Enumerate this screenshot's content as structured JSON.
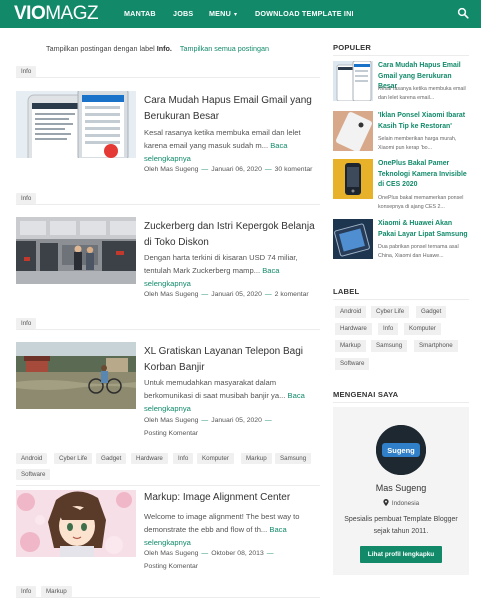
{
  "nav": {
    "logo_bold": "VIO",
    "logo_light": "MAGZ",
    "items": [
      "MANTAB",
      "JOBS",
      "MENU",
      "DOWNLOAD TEMPLATE INI"
    ],
    "menu_caret": "▾"
  },
  "notice": {
    "prefix": "Tampilkan postingan dengan label",
    "label": "Info.",
    "link": "Tampilkan semua postingan"
  },
  "posts": [
    {
      "tags": [
        "Info"
      ],
      "title": "Cara Mudah Hapus Email Gmail yang Berukuran Besar",
      "excerpt": "Kesal rasanya ketika membuka email dan lelet karena email yang masuk sudah m...",
      "more": "Baca selengkapnya",
      "author": "Oleh Mas Sugeng",
      "date": "Januari 06, 2020",
      "comments": "30 komentar"
    },
    {
      "tags": [
        "Info"
      ],
      "title": "Zuckerberg dan Istri Kepergok Belanja di Toko Diskon",
      "excerpt": "Dengan harta terkini di kisaran USD 74 miliar, tentulah Mark Zuckerberg mamp...",
      "more": "Baca selengkapnya",
      "author": "Oleh Mas Sugeng",
      "date": "Januari 05, 2020",
      "comments": "2 komentar"
    },
    {
      "tags": [
        "Info"
      ],
      "title": "XL Gratiskan Layanan Telepon Bagi Korban Banjir",
      "excerpt": "Untuk memudahkan masyarakat dalam berkomunikasi di saat musibah banjir ya...",
      "more": "Baca selengkapnya",
      "author": "Oleh Mas Sugeng",
      "date": "Januari 05, 2020",
      "comments": "Posting Komentar"
    },
    {
      "tags": [
        "Android",
        "Cyber Life",
        "Gadget",
        "Hardware",
        "Info",
        "Komputer",
        "Markup",
        "Samsung",
        "Software"
      ],
      "title": "Markup: Image Alignment Center",
      "excerpt": "Welcome to image alignment! The best way to demonstrate the ebb and flow of th...",
      "more": "Baca selengkapnya",
      "author": "Oleh Mas Sugeng",
      "date": "Oktober 08, 2013",
      "comments": "Posting Komentar"
    }
  ],
  "bottom_tags": [
    "Info",
    "Markup"
  ],
  "dash": "—",
  "sidebar": {
    "popular_heading": "POPULER",
    "popular": [
      {
        "title": "Cara Mudah Hapus Email Gmail yang Berukuran Besar",
        "excerpt": "Kesal rasanya ketika membuka email dan lelet karena email..."
      },
      {
        "title": "'Iklan Ponsel Xiaomi Ibarat Kasih Tip ke Restoran'",
        "excerpt": "Selain memberikan harga murah, Xiaomi pun kerap 'bo..."
      },
      {
        "title": "OnePlus Bakal Pamer Teknologi Kamera Invisible di CES 2020",
        "excerpt": "OnePlus bakal memamerkan ponsel konsepnya di ajang CES 2..."
      },
      {
        "title": "Xiaomi & Huawei Akan Pakai Layar Lipat Samsung",
        "excerpt": "Dua pabrikan ponsel ternama asal China, Xiaomi dan Huawe..."
      }
    ],
    "label_heading": "LABEL",
    "labels": [
      "Android",
      "Cyber Life",
      "Gadget",
      "Hardware",
      "Info",
      "Komputer",
      "Markup",
      "Samsung",
      "Smartphone",
      "Software"
    ],
    "about_heading": "MENGENAI SAYA",
    "about": {
      "avatar_text": "Sugeng",
      "name": "Mas Sugeng",
      "location": "Indonesia",
      "description": "Spesialis pembuat Template Blogger sejak tahun 2011.",
      "button": "Lihat profil lengkapku"
    }
  },
  "colors": {
    "accent": "#128a6a"
  }
}
